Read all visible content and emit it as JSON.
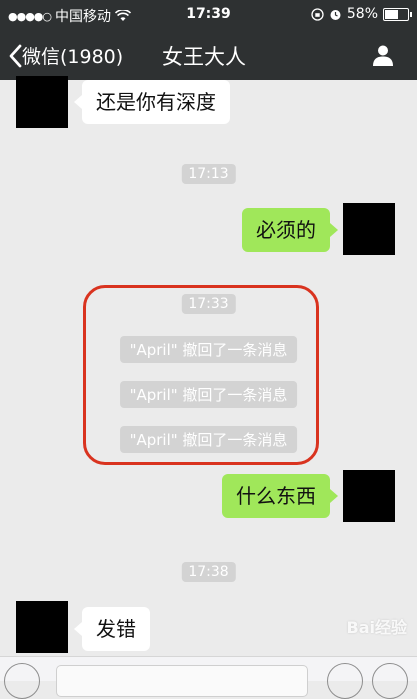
{
  "status_bar": {
    "carrier": "中国移动",
    "time": "17:39",
    "battery": "58%",
    "battery_level": 0.58
  },
  "header": {
    "back_label": "微信(1980)",
    "title": "女王大人"
  },
  "messages": {
    "m1": "还是你有深度",
    "t1": "17:13",
    "m2": "必须的",
    "t2": "17:33",
    "r1": "\"April\" 撤回了一条消息",
    "r2": "\"April\" 撤回了一条消息",
    "r3": "\"April\" 撤回了一条消息",
    "m3": "什么东西",
    "t3": "17:38",
    "m4": "发错"
  },
  "colors": {
    "header_bg": "#2e3132",
    "chat_bg": "#ebebeb",
    "sent_bubble": "#a0e75a",
    "highlight": "#d9331f"
  },
  "watermark": "Bai经验"
}
